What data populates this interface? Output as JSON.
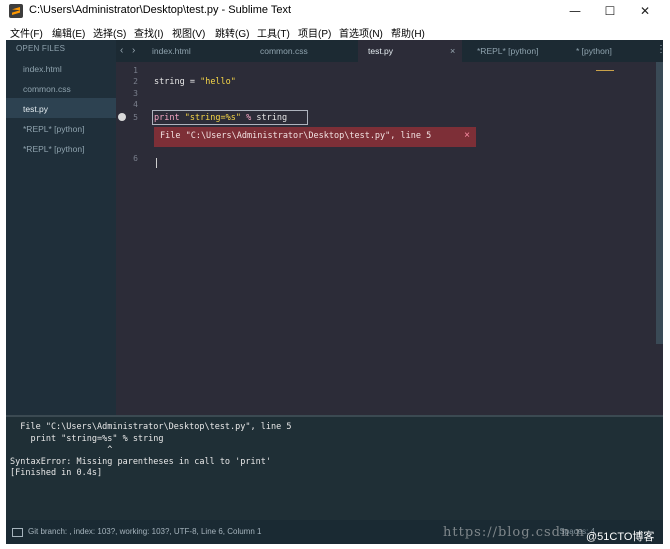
{
  "window": {
    "title": "C:\\Users\\Administrator\\Desktop\\test.py - Sublime Text",
    "minimize": "—",
    "maximize": "☐",
    "close": "✕"
  },
  "menu": [
    "文件(F)",
    "编辑(E)",
    "选择(S)",
    "查找(I)",
    "视图(V)",
    "跳转(G)",
    "工具(T)",
    "项目(P)",
    "首选项(N)",
    "帮助(H)"
  ],
  "sidebar": {
    "title": "OPEN FILES",
    "items": [
      "index.html",
      "common.css",
      "test.py",
      "*REPL* [python]",
      "*REPL* [python]"
    ]
  },
  "tabs": [
    "index.html",
    "common.css",
    "test.py",
    "*REPL* [python]",
    "* [python]"
  ],
  "tab_close": "×",
  "nav": {
    "back": "‹",
    "forward": "›"
  },
  "gutter": [
    "1",
    "2",
    "3",
    "4",
    "5",
    "6"
  ],
  "code": {
    "line2_name": "string",
    "line2_eq": " = ",
    "line2_str": "\"hello\"",
    "line5_kw": "print",
    "line5_str": " \"string=%s\"",
    "line5_op": " %",
    "line5_rest": " string"
  },
  "error": {
    "text": "File \"C:\\Users\\Administrator\\Desktop\\test.py\", line 5",
    "close": "×"
  },
  "output": [
    "  File \"C:\\Users\\Administrator\\Desktop\\test.py\", line 5",
    "    print \"string=%s\" % string",
    "                   ^",
    "SyntaxError: Missing parentheses in call to 'print'",
    "[Finished in 0.4s]"
  ],
  "status": {
    "text": "Git branch: , index: 103?, working: 103?, UTF-8, Line 6, Column 1",
    "right": "Spaces: 4"
  },
  "watermark": "https://blog.csdn.n",
  "watermark2": "@51CTO博客"
}
